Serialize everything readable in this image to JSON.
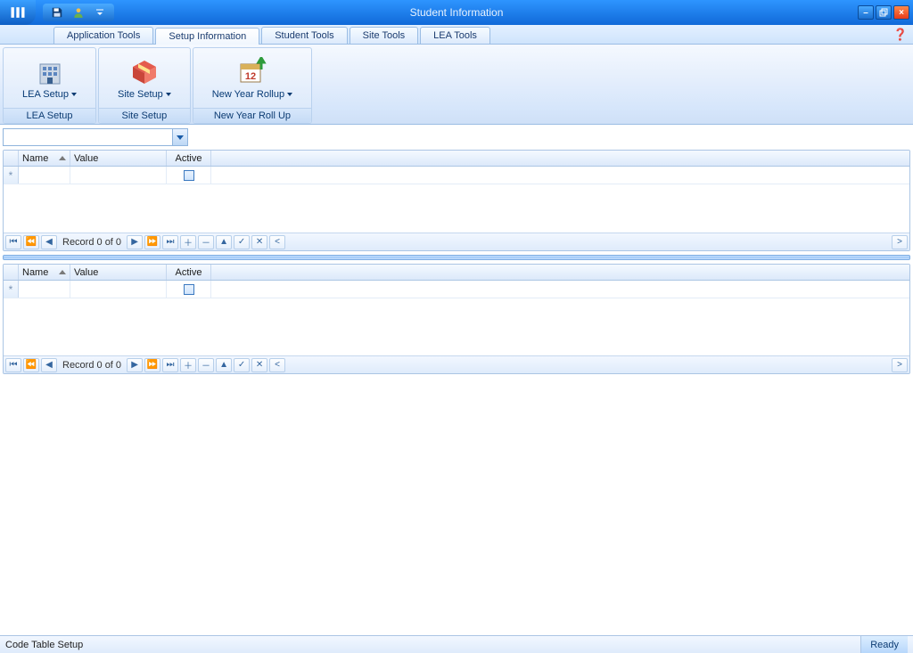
{
  "app": {
    "title": "Student Information"
  },
  "tabs": [
    {
      "label": "Application Tools",
      "active": false
    },
    {
      "label": "Setup Information",
      "active": true
    },
    {
      "label": "Student Tools",
      "active": false
    },
    {
      "label": "Site Tools",
      "active": false
    },
    {
      "label": "LEA Tools",
      "active": false
    }
  ],
  "ribbon": {
    "groups": [
      {
        "button": "LEA Setup",
        "caption": "LEA Setup"
      },
      {
        "button": "Site Setup",
        "caption": "Site Setup"
      },
      {
        "button": "New Year Rollup",
        "caption": "New Year Roll Up"
      }
    ]
  },
  "grid": {
    "cols": {
      "name": "Name",
      "value": "Value",
      "active": "Active"
    },
    "nav": {
      "record": "Record 0 of 0"
    }
  },
  "status": {
    "left": "Code Table Setup",
    "right": "Ready"
  }
}
